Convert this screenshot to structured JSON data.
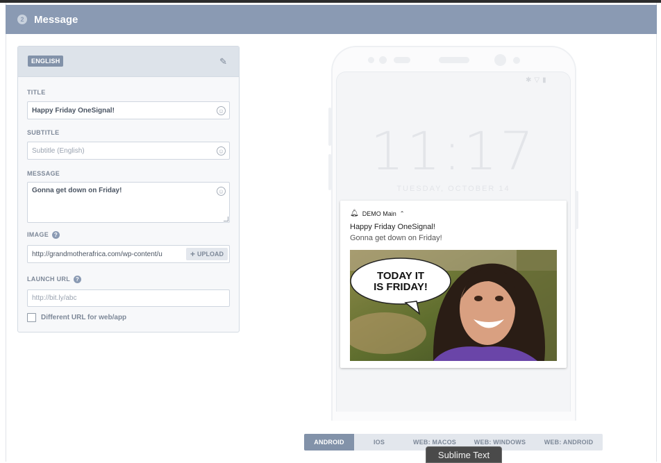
{
  "header": {
    "step": "2",
    "title": "Message"
  },
  "form": {
    "language": "ENGLISH",
    "title_label": "TITLE",
    "title_value": "Happy Friday OneSignal!",
    "subtitle_label": "SUBTITLE",
    "subtitle_placeholder": "Subtitle (English)",
    "message_label": "MESSAGE",
    "message_value": "Gonna get down on Friday!",
    "image_label": "IMAGE",
    "image_url": "http://grandmotherafrica.com/wp-content/u",
    "upload_label": "UPLOAD",
    "launch_label": "LAUNCH URL",
    "launch_placeholder": "http://bit.ly/abc",
    "different_url_label": "Different URL for web/app"
  },
  "preview": {
    "time": "11:17",
    "date": "TUESDAY, OCTOBER 14",
    "app_name": "DEMO Main",
    "notif_title": "Happy Friday OneSignal!",
    "notif_message": "Gonna get down on Friday!",
    "image_caption_line1": "TODAY IT",
    "image_caption_line2": "IS FRIDAY!"
  },
  "platform_tabs": [
    {
      "label": "ANDROID",
      "active": true
    },
    {
      "label": "IOS",
      "active": false
    },
    {
      "label": "WEB: MACOS",
      "active": false
    },
    {
      "label": "WEB: WINDOWS",
      "active": false
    },
    {
      "label": "WEB: ANDROID",
      "active": false
    }
  ],
  "tooltip": "Sublime Text",
  "colors": {
    "header": "#8a9ab3",
    "accent": "#8292a9"
  }
}
